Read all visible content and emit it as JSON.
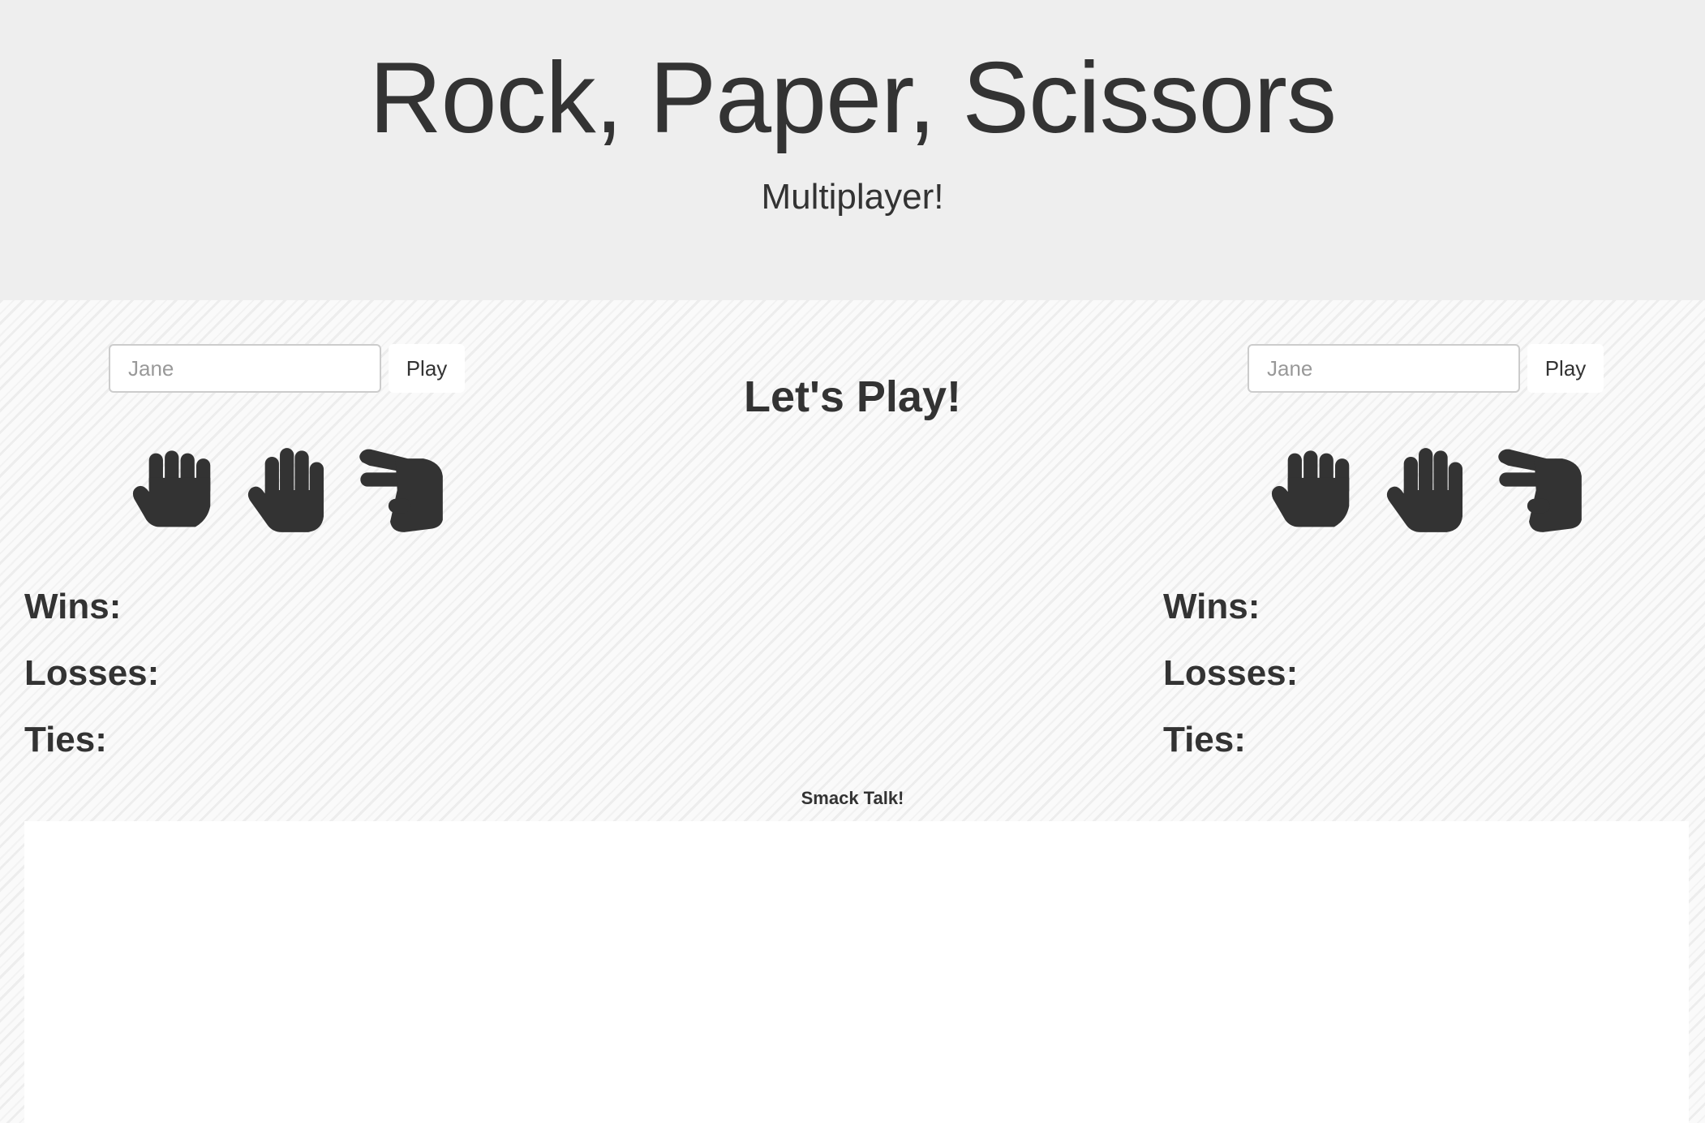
{
  "header": {
    "title": "Rock, Paper, Scissors",
    "subtitle": "Multiplayer!"
  },
  "center": {
    "status": "Let's Play!"
  },
  "player1": {
    "name_placeholder": "Jane",
    "name_value": "",
    "play_label": "Play",
    "choices": [
      "rock-icon",
      "paper-icon",
      "scissors-icon"
    ],
    "wins_label": "Wins:",
    "losses_label": "Losses:",
    "ties_label": "Ties:"
  },
  "player2": {
    "name_placeholder": "Jane",
    "name_value": "",
    "play_label": "Play",
    "choices": [
      "rock-icon",
      "paper-icon",
      "scissors-icon"
    ],
    "wins_label": "Wins:",
    "losses_label": "Losses:",
    "ties_label": "Ties:"
  },
  "chat": {
    "label": "Smack Talk!",
    "messages": []
  },
  "colors": {
    "text": "#333333",
    "header_bg": "#eeeeee",
    "panel_bg": "#ffffff"
  }
}
